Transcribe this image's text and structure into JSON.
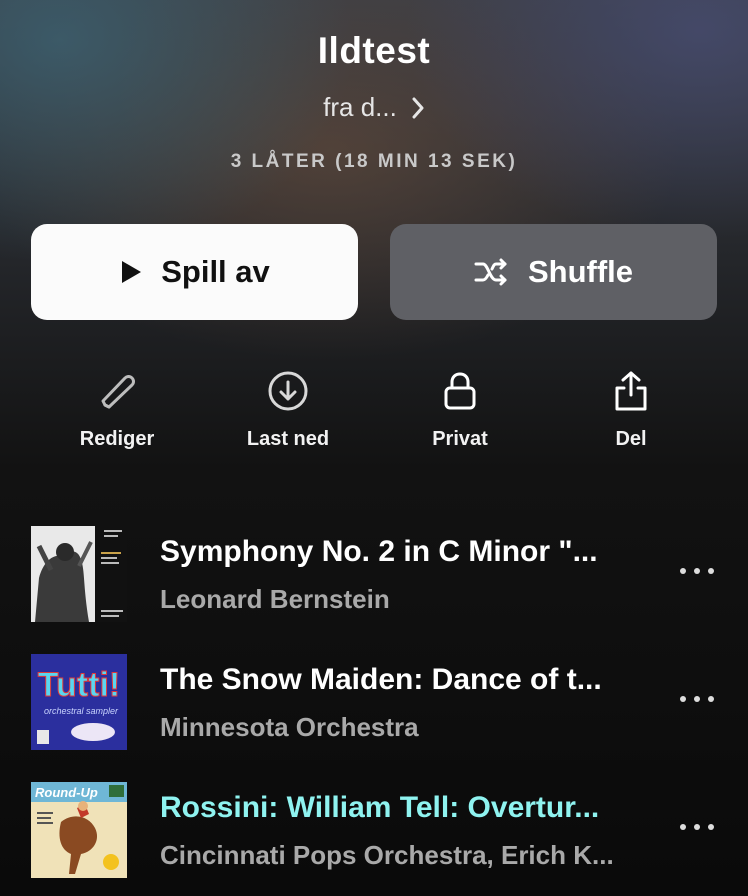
{
  "playlist": {
    "title": "Ildtest",
    "owner": "fra d...",
    "meta": "3 LÅTER (18 MIN 13 SEK)"
  },
  "buttons": {
    "play": "Spill av",
    "shuffle": "Shuffle"
  },
  "actions": [
    {
      "label": "Rediger",
      "icon": "pencil-icon"
    },
    {
      "label": "Last ned",
      "icon": "download-circle-icon"
    },
    {
      "label": "Privat",
      "icon": "lock-icon"
    },
    {
      "label": "Del",
      "icon": "share-icon"
    }
  ],
  "tracks": [
    {
      "title": "Symphony No. 2 in C Minor \"...",
      "artist": "Leonard Bernstein",
      "active": false
    },
    {
      "title": "The Snow Maiden: Dance of t...",
      "artist": "Minnesota Orchestra",
      "active": false
    },
    {
      "title": "Rossini: William Tell: Overtur...",
      "artist": "Cincinnati Pops Orchestra, Erich K...",
      "active": true
    }
  ],
  "album_art": {
    "tutti_title": "Tutti!",
    "tutti_subtitle": "orchestral sampler",
    "roundup_title": "Round-Up"
  },
  "colors": {
    "active_track": "#8ff3f0",
    "artist_text": "#a9a9a9"
  }
}
